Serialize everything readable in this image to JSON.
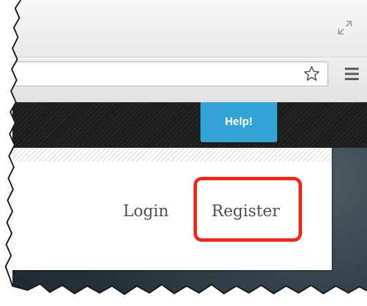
{
  "browser": {
    "address_bar": {
      "value": "",
      "placeholder": ""
    },
    "icons": [
      "restore-icon",
      "bookmark-star-icon",
      "menu-icon"
    ]
  },
  "header": {
    "help_label": "Help!",
    "help_color": "#36a3d6"
  },
  "nav": {
    "login_label": "Login",
    "register_label": "Register"
  },
  "annotation": {
    "highlight_color": "#ee2a1b",
    "highlighted_item": "Register"
  }
}
